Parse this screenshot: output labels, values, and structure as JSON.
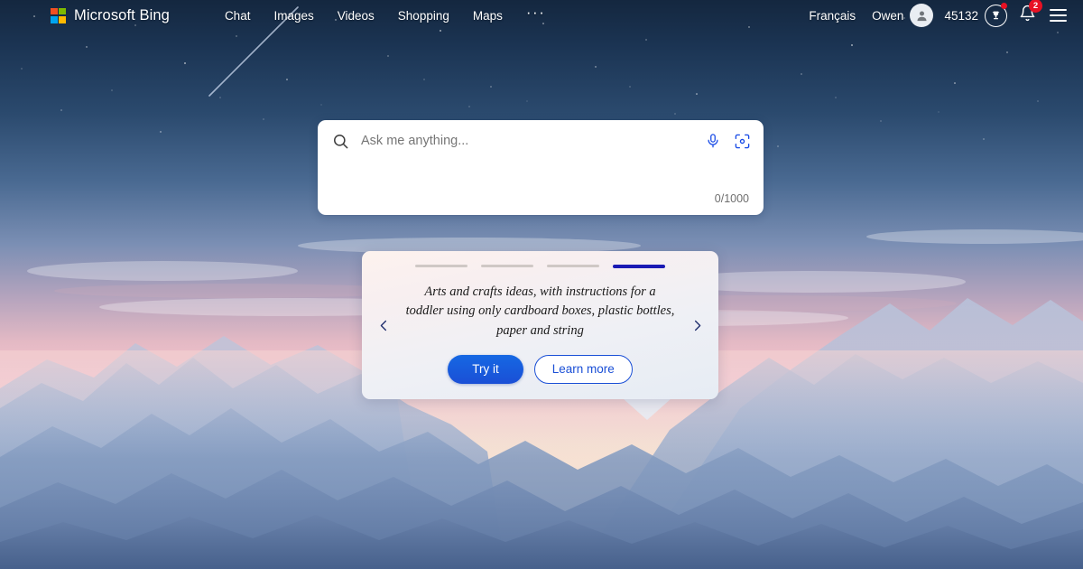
{
  "header": {
    "brand": "Microsoft Bing",
    "brand_logo_icon": "microsoft-logo-icon",
    "nav": [
      {
        "label": "Chat",
        "name": "nav-chat"
      },
      {
        "label": "Images",
        "name": "nav-images"
      },
      {
        "label": "Videos",
        "name": "nav-videos"
      },
      {
        "label": "Shopping",
        "name": "nav-shopping"
      },
      {
        "label": "Maps",
        "name": "nav-maps"
      }
    ],
    "more_label": "···",
    "language": "Français",
    "user_name": "Owen",
    "avatar_icon": "person-icon",
    "rewards_points": "45132",
    "rewards_icon": "trophy-icon",
    "rewards_has_alert": true,
    "notifications_icon": "bell-icon",
    "notifications_count": "2",
    "menu_icon": "hamburger-menu-icon"
  },
  "search": {
    "placeholder": "Ask me anything...",
    "value": "",
    "search_icon": "search-icon",
    "mic_icon": "microphone-icon",
    "visual_search_icon": "visual-search-icon",
    "char_counter": "0/1000"
  },
  "carousel": {
    "prev_icon": "chevron-left-icon",
    "next_icon": "chevron-right-icon",
    "slide_count": 4,
    "active_slide": 4,
    "text": "Arts and crafts ideas, with instructions for a toddler using only cardboard boxes, plastic bottles, paper and string",
    "primary_button": "Try it",
    "secondary_button": "Learn more"
  },
  "theme": {
    "accent_blue": "#1a4fd6",
    "active_bar": "#1a1ab4",
    "badge_red": "#e81123",
    "sky_top": "#17304f",
    "sky_pink": "#f3c2cf",
    "mountain_far": "#9fb4d6"
  },
  "background": {
    "description": "night-to-sunset sky over layered mountain silhouettes",
    "shooting_star": "shooting-star-icon"
  }
}
